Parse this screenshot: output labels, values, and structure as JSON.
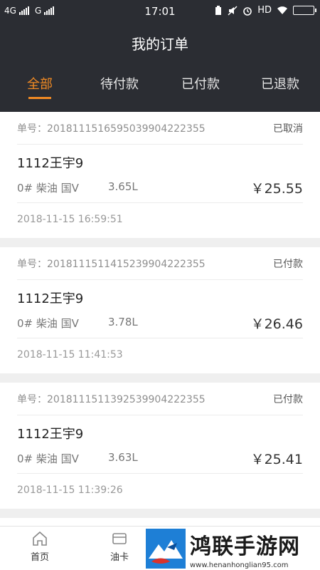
{
  "status_bar": {
    "network1": "4G",
    "network2": "G",
    "time": "17:01",
    "hd": "HD"
  },
  "header": {
    "title": "我的订单"
  },
  "tabs": [
    {
      "label": "全部",
      "active": true
    },
    {
      "label": "待付款",
      "active": false
    },
    {
      "label": "已付款",
      "active": false
    },
    {
      "label": "已退款",
      "active": false
    }
  ],
  "orders": [
    {
      "order_no": "单号：2018111516595039904222355",
      "status": "已取消",
      "plate": "1112王宇9",
      "fuel": "0# 柴油 国Ⅴ",
      "volume": "3.65L",
      "price": "￥25.55",
      "time": "2018-11-15 16:59:51"
    },
    {
      "order_no": "单号：2018111511415239904222355",
      "status": "已付款",
      "plate": "1112王宇9",
      "fuel": "0# 柴油 国Ⅴ",
      "volume": "3.78L",
      "price": "￥26.46",
      "time": "2018-11-15 11:41:53"
    },
    {
      "order_no": "单号：2018111511392539904222355",
      "status": "已付款",
      "plate": "1112王宇9",
      "fuel": "0# 柴油 国Ⅴ",
      "volume": "3.63L",
      "price": "￥25.41",
      "time": "2018-11-15 11:39:26"
    }
  ],
  "bottom_nav": [
    {
      "label": "首页",
      "icon": "home-icon"
    },
    {
      "label": "油卡",
      "icon": "card-icon"
    }
  ],
  "watermark": {
    "title": "鸿联手游网",
    "url": "www.henanhonglian95.com"
  }
}
